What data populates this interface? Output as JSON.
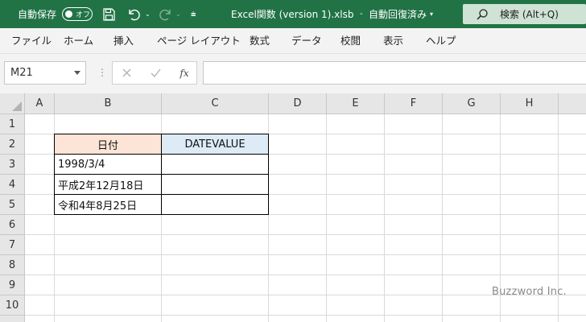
{
  "titlebar": {
    "autosave_label": "自動保存",
    "autosave_state": "オフ",
    "doc_title": "Excel関数 (version 1).xlsb",
    "save_status": "自動回復済み",
    "search_label": "検索 (Alt+Q)"
  },
  "menu": {
    "tabs": [
      "ファイル",
      "ホーム",
      "挿入",
      "ページ レイアウト",
      "数式",
      "データ",
      "校閲",
      "表示",
      "ヘルプ"
    ]
  },
  "formula_bar": {
    "name_box": "M21",
    "fx_label": "fx",
    "formula": ""
  },
  "sheet": {
    "columns": [
      "A",
      "B",
      "C",
      "D",
      "E",
      "F",
      "G",
      "H"
    ],
    "rows": [
      "1",
      "2",
      "3",
      "4",
      "5",
      "6",
      "7",
      "8",
      "9",
      "10"
    ],
    "header_b": "日付",
    "header_c": "DATEVALUE",
    "dates": [
      "1998/3/4",
      "平成2年12月18日",
      "令和4年8月25日"
    ],
    "header_b_color": "#fce4d6",
    "header_c_color": "#ddebf7"
  },
  "watermark": "Buzzword Inc.",
  "colors": {
    "title_bar": "#217346",
    "menu_bg": "#f3f3f3",
    "header_bg": "#e6e6e6"
  }
}
